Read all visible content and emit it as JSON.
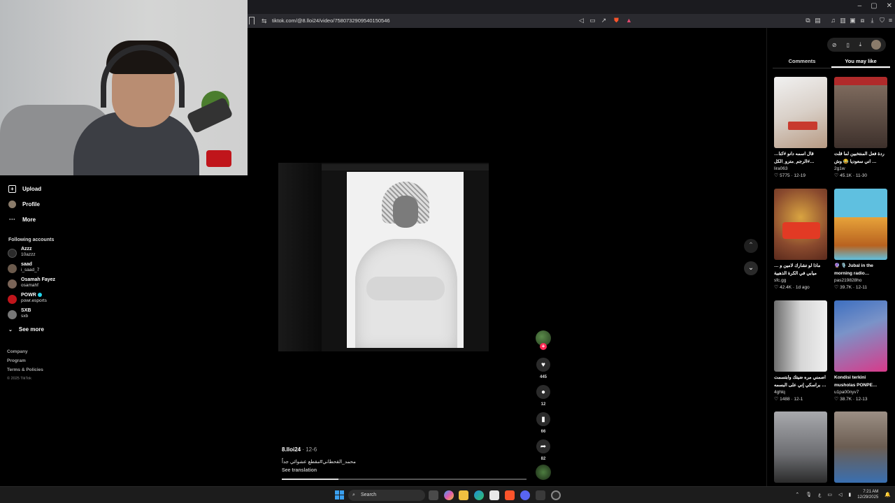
{
  "browser": {
    "url": "tiktok.com/@8.lloi24/video/7580732909540150546",
    "window_controls": [
      "–",
      "▢",
      "✕"
    ]
  },
  "sidebar": {
    "nav": [
      {
        "label": "Upload",
        "icon": "plus-square-icon"
      },
      {
        "label": "Profile",
        "icon": "avatar-icon"
      },
      {
        "label": "More",
        "icon": "more-dots-icon"
      }
    ],
    "following_header": "Following accounts",
    "accounts": [
      {
        "name": "Azzz",
        "handle": "10azzz",
        "color": "#2b2b2b",
        "verified": false
      },
      {
        "name": "saad",
        "handle": "i_saad_7",
        "color": "#6b5a4c",
        "verified": false
      },
      {
        "name": "Osamah Fayez",
        "handle": "osamahf",
        "color": "#7a6457",
        "verified": false
      },
      {
        "name": "POWR",
        "handle": "powr.esports",
        "color": "#c0151b",
        "verified": true
      },
      {
        "name": "SXB",
        "handle": "sxb",
        "color": "#777777",
        "verified": false
      }
    ],
    "see_more": "See more",
    "footer": [
      "Company",
      "Program",
      "Terms & Policies"
    ],
    "copyright": "© 2025 TikTok"
  },
  "video": {
    "username": "8.lloi24",
    "date": " · 12-6",
    "caption": "محمد_القحطاني#مقطع عشوائي جداً",
    "see_translation": "See translation",
    "progress": 0.23,
    "likes": "445",
    "comments": "12",
    "saves": "66",
    "shares": "82"
  },
  "right_panel": {
    "tabs": [
      "Comments",
      "You may like"
    ],
    "active_tab": "You may like",
    "cards": [
      {
        "title": "قال اسمه دانو #كنا… #الرجم_مترو_الكل…",
        "user": "lira063",
        "likes": "5775",
        "date": "12-19",
        "bg": "#e9e9e9",
        "accent": "#c83a2e"
      },
      {
        "title": "ردة فعل المنتخبين لما قلت … اني سعوديا 😂 وش",
        "user": "2g1w",
        "likes": "45.1K",
        "date": "11-30",
        "bg": "#5b4036",
        "accent": "#b02a2a"
      },
      {
        "title": "ماذا لو تشارك لامين و … ميابي في الكرة الذهبية",
        "user": "sfc.gg",
        "likes": "42.4K",
        "date": "1d ago",
        "bg": "#6b4a3a",
        "accent": "#e23a24"
      },
      {
        "title": "🔮 🎙️ Jubal in the morning radio…",
        "user": "pas219828ho",
        "likes": "39.7K",
        "date": "12-11",
        "bg": "#55b7d9",
        "accent": "#e7a33a"
      },
      {
        "title": "اصمني مره ضيتك وابتسمت … براسكي إني على البسمه",
        "user": "4ghlq",
        "likes": "1488",
        "date": "12-1",
        "bg": "#cfcfcf",
        "accent": "#4a4a4a"
      },
      {
        "title": "Kondisi terkini musholas PONPE…",
        "user": "u1pa00nyv7",
        "likes": "38.7K",
        "date": "12-13",
        "bg": "#3d6fc0",
        "accent": "#d83a8a"
      },
      {
        "title": "",
        "user": "",
        "likes": "",
        "date": "",
        "bg": "#8d8f93",
        "accent": "#2b2b2b"
      },
      {
        "title": "",
        "user": "",
        "likes": "",
        "date": "",
        "bg": "#6b5d52",
        "accent": "#3a6fb0"
      }
    ]
  },
  "taskbar": {
    "search_placeholder": "Search",
    "time": "7:21 AM",
    "date": "12/29/2025",
    "lang": "ع"
  }
}
